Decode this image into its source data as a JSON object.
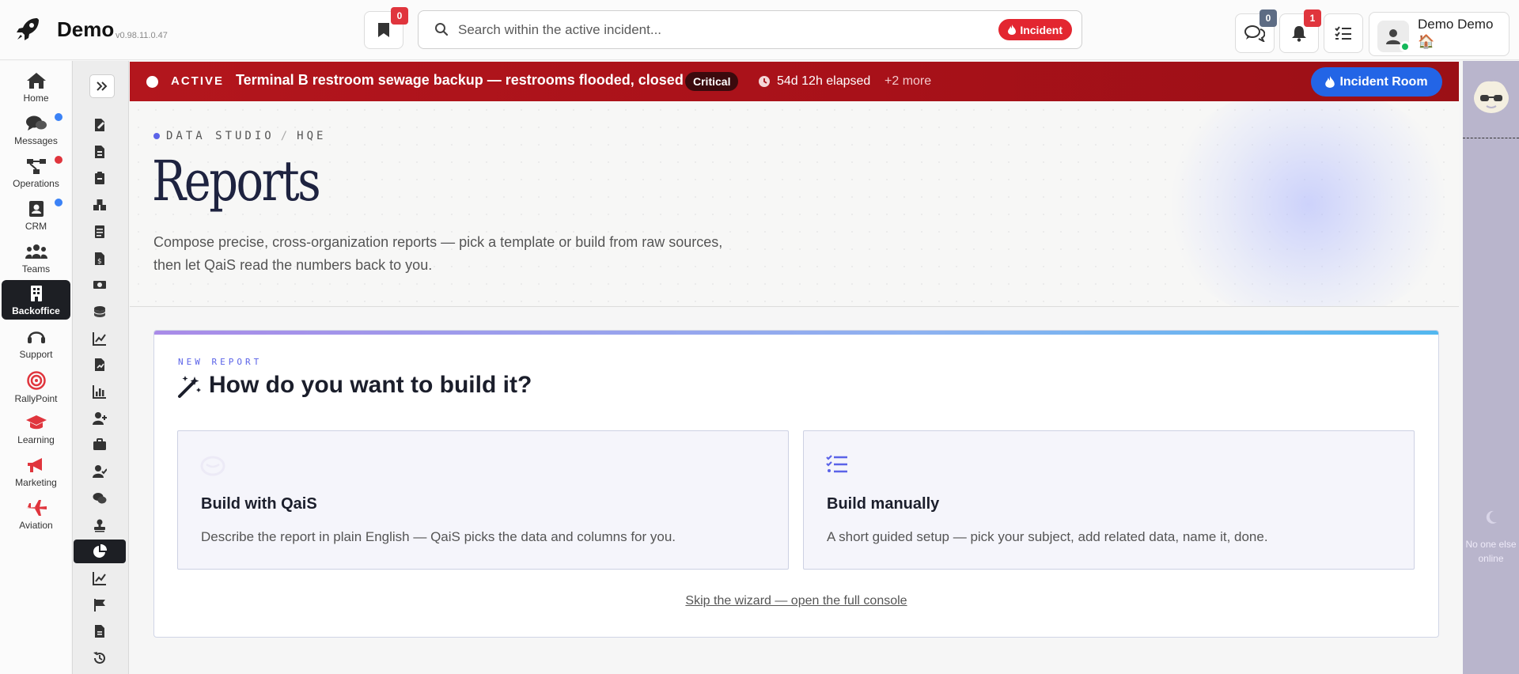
{
  "app": {
    "name": "Demo",
    "version": "v0.98.11.0.47"
  },
  "topbar": {
    "bookmarks_count": "0",
    "search": {
      "placeholder": "Search within the active incident...",
      "value": "",
      "scope_label": "Incident"
    },
    "chat_count": "0",
    "notifications_count": "1",
    "user": {
      "name": "Demo Demo",
      "home_emoji": "🏠"
    }
  },
  "nav": {
    "items": [
      {
        "label": "Home",
        "icon": "home-icon"
      },
      {
        "label": "Messages",
        "icon": "chat-icon",
        "dot_color": "#3b82f6"
      },
      {
        "label": "Operations",
        "icon": "network-icon",
        "dot_color": "#e0353d"
      },
      {
        "label": "CRM",
        "icon": "contacts-icon",
        "dot_color": "#3b82f6"
      },
      {
        "label": "Teams",
        "icon": "teams-icon"
      },
      {
        "label": "Backoffice",
        "icon": "building-icon",
        "active": true
      },
      {
        "label": "Support",
        "icon": "headset-icon"
      },
      {
        "label": "RallyPoint",
        "icon": "target-icon"
      },
      {
        "label": "Learning",
        "icon": "graduation-cap-icon"
      },
      {
        "label": "Marketing",
        "icon": "megaphone-icon"
      },
      {
        "label": "Aviation",
        "icon": "plane-icon"
      }
    ]
  },
  "rail": {
    "icons": [
      "file-signature-icon",
      "file-invoice-icon",
      "clipboard-icon",
      "boxes-icon",
      "document-icon",
      "invoice-dollar-icon",
      "money-icon",
      "coins-icon",
      "line-chart-icon",
      "chart-edit-icon",
      "bar-chart-icon",
      "user-plus-icon",
      "briefcase-icon",
      "user-check-icon",
      "comments-icon",
      "stamp-icon",
      "pie-chart-icon",
      "trend-chart-icon",
      "flag-icon",
      "file-icon",
      "history-icon"
    ],
    "active_index": 16
  },
  "banner": {
    "status": "ACTIVE",
    "title": "Terminal B restroom sewage backup — restrooms flooded, closed",
    "severity": "Critical",
    "elapsed": "54d 12h elapsed",
    "more": "+2 more",
    "room_button": "Incident Room"
  },
  "hero": {
    "breadcrumb": [
      "DATA STUDIO",
      "HQE"
    ],
    "title": "Reports",
    "description": "Compose precise, cross-organization reports — pick a template or build from raw sources, then let QaiS read the numbers back to you."
  },
  "wizard": {
    "eyebrow": "NEW REPORT",
    "title": "How do you want to build it?",
    "options": [
      {
        "title": "Build with QaiS",
        "description": "Describe the report in plain English — QaiS picks the data and columns for you.",
        "icon": "qais-mascot-icon"
      },
      {
        "title": "Build manually",
        "description": "A short guided setup — pick your subject, add related data, name it, done.",
        "icon": "list-check-icon"
      }
    ],
    "skip_link": "Skip the wizard — open the full console"
  },
  "presence": {
    "empty_text": "No one else online"
  },
  "colors": {
    "accent": "#5b63e8",
    "incident_red": "#b3161d",
    "primary_blue": "#2365e6"
  }
}
